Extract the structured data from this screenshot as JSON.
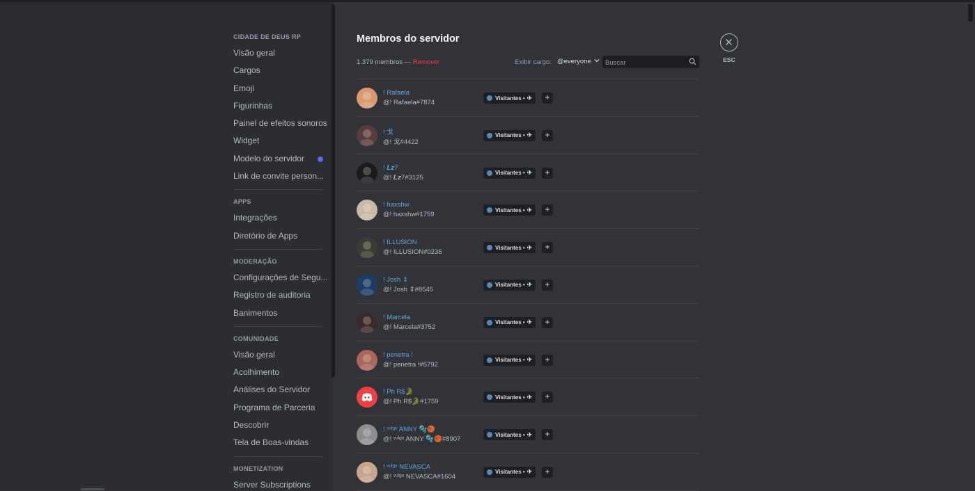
{
  "sidebar": {
    "sections": [
      {
        "title": "CIDADE DE DEUS RP",
        "items": [
          "Visão geral",
          "Cargos",
          "Emoji",
          "Figurinhas",
          "Painel de efeitos sonoros",
          "Widget",
          "Modelo do servidor",
          "Link de convite person..."
        ]
      },
      {
        "title": "APPS",
        "items": [
          "Integrações",
          "Diretório de Apps"
        ]
      },
      {
        "title": "MODERAÇÃO",
        "items": [
          "Configurações de Segu...",
          "Registro de auditoria",
          "Banimentos"
        ]
      },
      {
        "title": "COMUNIDADE",
        "items": [
          "Visão geral",
          "Acolhimento",
          "Análises do Servidor",
          "Programa de Parceria",
          "Descobrir",
          "Tela de Boas-vindas"
        ]
      },
      {
        "title": "MONETIZATION",
        "items": [
          "Server Subscriptions"
        ]
      }
    ],
    "notification_dot_color": "#5865f2"
  },
  "header": {
    "title": "Membros do servidor",
    "member_count": "1.379 membros",
    "separator": "—",
    "remove_label": "Remover",
    "role_filter_label": "Exibir cargo:",
    "role_filter_value": "@everyone",
    "search_placeholder": "Buscar"
  },
  "members": [
    {
      "name": "! Rafaela",
      "tag": "@! Rafaela#7874",
      "role": "Visitantes •",
      "avatar_color": "#d99a72"
    },
    {
      "name": "! 戈",
      "tag": "@! 戈#4422",
      "role": "Visitantes •",
      "avatar_color": "#5a3c3c"
    },
    {
      "name": "! 𝑳𝒛7",
      "tag": "@! 𝑳𝒛7#3125",
      "role": "Visitantes •",
      "avatar_color": "#1b1b1b"
    },
    {
      "name": "! haxshw",
      "tag": "@! haxshw#1759",
      "role": "Visitantes •",
      "avatar_color": "#c8b9a6"
    },
    {
      "name": "! ILLUSION",
      "tag": "@! ILLUSION#0236",
      "role": "Visitantes •",
      "avatar_color": "#3a3d30"
    },
    {
      "name": "! Josh ⇕",
      "tag": "@! Josh ⇕#8545",
      "role": "Visitantes •",
      "avatar_color": "#1c3d66"
    },
    {
      "name": "! Marcela",
      "tag": "@! Marcela#3752",
      "role": "Visitantes •",
      "avatar_color": "#3b2a2a"
    },
    {
      "name": "! penetra !",
      "tag": "@! penetra !#5792",
      "role": "Visitantes •",
      "avatar_color": "#a8675a"
    },
    {
      "name": "! Ph R$🐊",
      "tag": "@! Ph R$🐊#1759",
      "role": "Visitantes •",
      "avatar_color": "#ed4245"
    },
    {
      "name": "! ᵛᵘˡᵍᵒ ANNY 🫧🏀",
      "tag": "@! ᵛᵘˡᵍᵒ ANNY 🫧🏀#8907",
      "role": "Visitantes •",
      "avatar_color": "#8d8d8d"
    },
    {
      "name": "! ᵛᵘˡᵍᵒ NEVASCA",
      "tag": "@! ᵛᵘˡᵍᵒ NEVASCA#1604",
      "role": "Visitantes •",
      "avatar_color": "#c7a48c"
    }
  ],
  "role_dot_color": "#5a88b6",
  "role_icon": "airplane-icon",
  "add_role_label": "+",
  "close": {
    "label": "ESC",
    "icon": "close-icon"
  }
}
